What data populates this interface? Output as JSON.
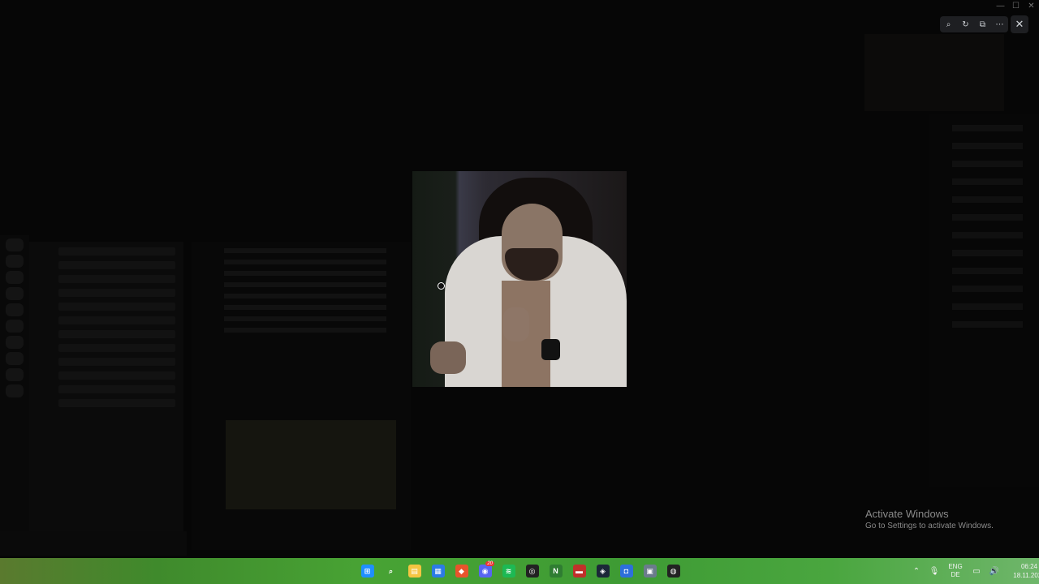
{
  "lightbox": {
    "toolbar": [
      {
        "name": "zoom-icon",
        "glyph": "⌕"
      },
      {
        "name": "rotate-icon",
        "glyph": "↻"
      },
      {
        "name": "open-external-icon",
        "glyph": "⧉"
      },
      {
        "name": "more-icon",
        "glyph": "⋯"
      }
    ],
    "close_glyph": "✕"
  },
  "windows": {
    "minimize": "—",
    "maximize": "☐",
    "close": "✕"
  },
  "watermark": {
    "title": "Activate Windows",
    "subtitle": "Go to Settings to activate Windows."
  },
  "taskbar": {
    "apps": [
      {
        "name": "start-icon",
        "glyph": "⊞",
        "color": "#1f8fff"
      },
      {
        "name": "search-icon",
        "glyph": "⌕",
        "color": "transparent"
      },
      {
        "name": "file-explorer-icon",
        "glyph": "▤",
        "color": "#f5c542"
      },
      {
        "name": "store-icon",
        "glyph": "▦",
        "color": "#2c7be5"
      },
      {
        "name": "brave-icon",
        "glyph": "◆",
        "color": "#e8542c"
      },
      {
        "name": "discord-icon",
        "glyph": "◉",
        "color": "#5865f2",
        "badge": "20"
      },
      {
        "name": "spotify-icon",
        "glyph": "≋",
        "color": "#1db954"
      },
      {
        "name": "obs-icon",
        "glyph": "◎",
        "color": "#222222"
      },
      {
        "name": "nvidia-icon",
        "glyph": "N",
        "color": "#2f7d32"
      },
      {
        "name": "recorder-icon",
        "glyph": "▬",
        "color": "#c0302a"
      },
      {
        "name": "steam-icon",
        "glyph": "◈",
        "color": "#1b2838"
      },
      {
        "name": "roblox-icon",
        "glyph": "◘",
        "color": "#2d6fdb"
      },
      {
        "name": "app-window-icon",
        "glyph": "▣",
        "color": "#6b7b8c"
      },
      {
        "name": "webcam-app-icon",
        "glyph": "◍",
        "color": "#222222"
      }
    ],
    "tray": {
      "chevron": "⌃",
      "mic": "🎙",
      "lang_top": "ENG",
      "lang_bottom": "DE",
      "network": "▭",
      "volume": "🔊",
      "time": "06:24",
      "date": "18.11.2025"
    }
  }
}
